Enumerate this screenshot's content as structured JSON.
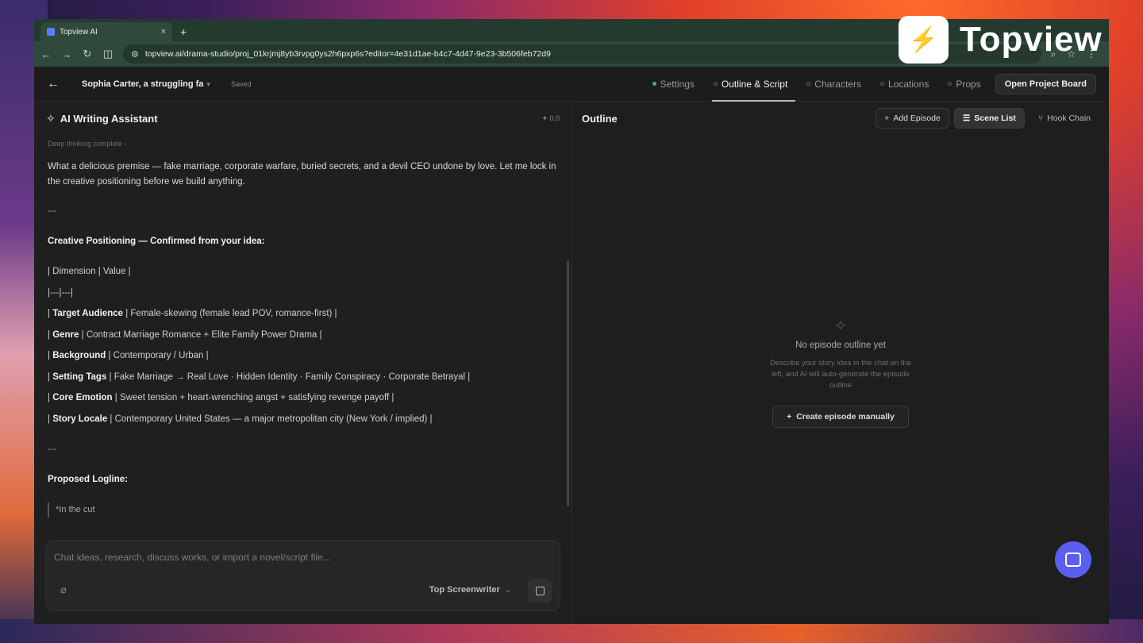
{
  "browser": {
    "tab_title": "Topview AI",
    "url": "topview.ai/drama-studio/proj_01krjmj8yb3rvpg0ys2h6pxp6s?editor=4e31d1ae-b4c7-4d47-9e23-3b506feb72d9"
  },
  "header": {
    "project_name": "Sophia Carter, a struggling fa",
    "status": "Saved",
    "tabs": [
      {
        "label": "Settings"
      },
      {
        "label": "Outline & Script"
      },
      {
        "label": "Characters"
      },
      {
        "label": "Locations"
      },
      {
        "label": "Props"
      }
    ],
    "board_button": "Open Project Board"
  },
  "assistant": {
    "title": "AI Writing Assistant",
    "counter": "0.0",
    "thinking": "Deep thinking complete",
    "intro": "What a delicious premise — fake marriage, corporate warfare, buried secrets, and a devil CEO undone by love. Let me lock in the creative positioning before we build anything.",
    "separator": "---",
    "section_heading": "Creative Positioning — Confirmed from your idea:",
    "table_header": "| Dimension | Value |",
    "table_divider": "|---|---|",
    "rows": [
      {
        "key": "Target Audience",
        "value": "Female-skewing (female lead POV, romance-first)"
      },
      {
        "key": "Genre",
        "value": "Contract Marriage Romance + Elite Family Power Drama"
      },
      {
        "key": "Background",
        "value": "Contemporary / Urban"
      },
      {
        "key": "Setting Tags",
        "value": "Fake Marriage → Real Love · Hidden Identity · Family Conspiracy · Corporate Betrayal"
      },
      {
        "key": "Core Emotion",
        "value": "Sweet tension + heart-wrenching angst + satisfying revenge payoff"
      },
      {
        "key": "Story Locale",
        "value": "Contemporary United States — a major metropolitan city (New York / implied)"
      }
    ],
    "logline_heading": "Proposed Logline:",
    "logline_preview": "*In the cut",
    "composer_placeholder": "Chat ideas, research, discuss works, or import a novel/script file...",
    "model": "Top Screenwriter"
  },
  "outline": {
    "title": "Outline",
    "add_episode": "Add Episode",
    "scene_list": "Scene List",
    "hook_chain": "Hook Chain",
    "empty_title": "No episode outline yet",
    "empty_desc": "Describe your story idea in the chat on the left, and AI will auto-generate the episode outline",
    "create_manual": "Create episode manually"
  },
  "overlay": {
    "logo_text": "Topview"
  },
  "colors": {
    "accent_green": "#4caf7a",
    "chat_bubble": "#5a5ff0"
  }
}
